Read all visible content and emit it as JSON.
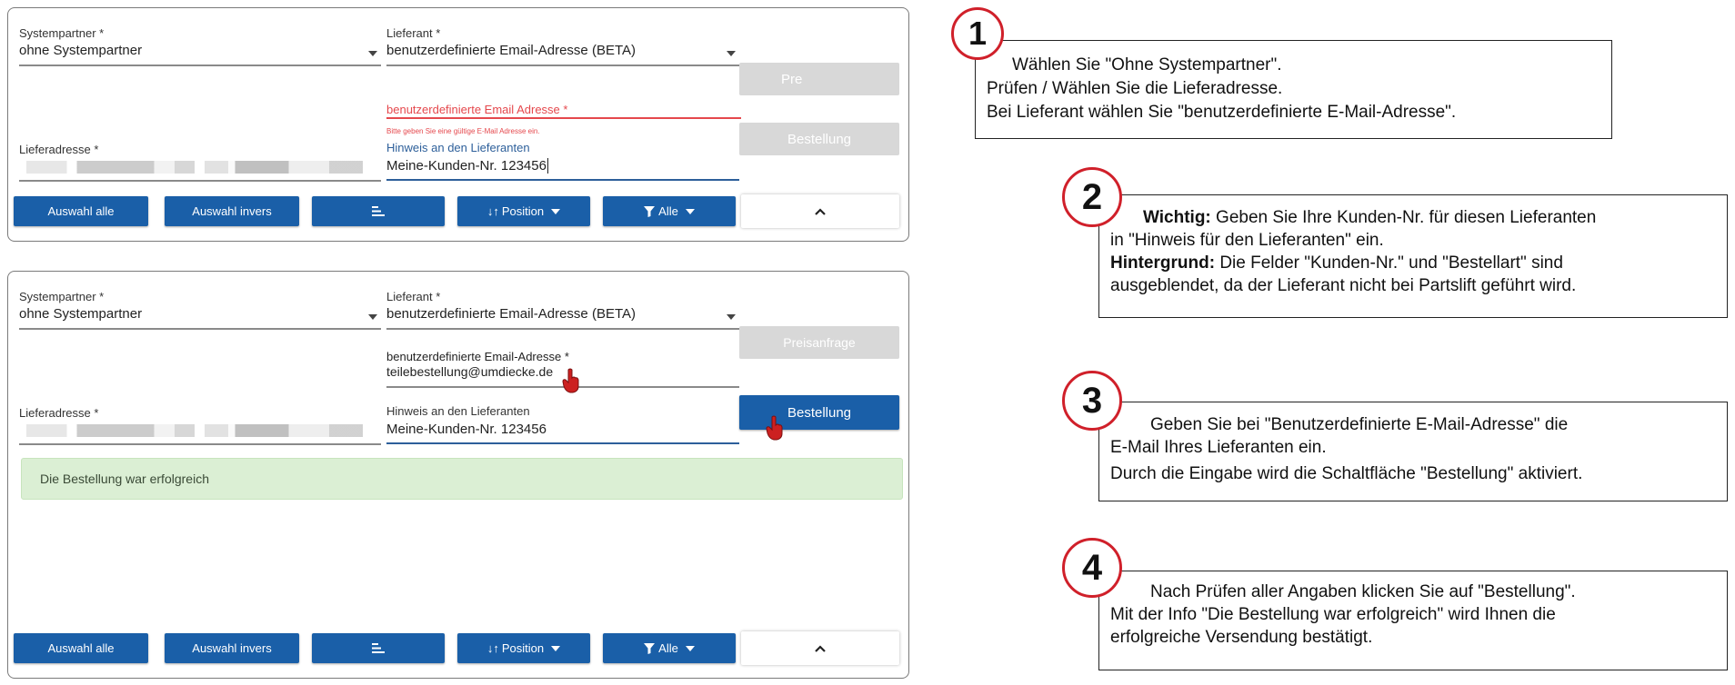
{
  "panel1": {
    "systempartner_label": "Systempartner *",
    "systempartner_value": "ohne Systempartner",
    "lieferant_label": "Lieferant *",
    "lieferant_value": "benutzerdefinierte Email-Adresse (BETA)",
    "email_label": "benutzerdefinierte Email Adresse *",
    "email_error": "Bitte geben Sie eine gültige E-Mail Adresse ein.",
    "hinweis_label": "Hinweis an den Lieferanten",
    "hinweis_value": "Meine-Kunden-Nr. 123456",
    "lieferadresse_label": "Lieferadresse *",
    "preisanfrage_button": "Pre",
    "bestellung_button": "Bestellung",
    "auswahl_alle": "Auswahl alle",
    "auswahl_invers": "Auswahl invers",
    "position": "Position",
    "filter": "Alle"
  },
  "panel2": {
    "systempartner_label": "Systempartner *",
    "systempartner_value": "ohne Systempartner",
    "lieferant_label": "Lieferant *",
    "lieferant_value": "benutzerdefinierte Email-Adresse (BETA)",
    "email_label": "benutzerdefinierte Email-Adresse *",
    "email_value": "teilebestellung@umdiecke.de",
    "hinweis_label": "Hinweis an den Lieferanten",
    "hinweis_value": "Meine-Kunden-Nr. 123456",
    "lieferadresse_label": "Lieferadresse *",
    "preisanfrage_button": "Preisanfrage",
    "bestellung_button": "Bestellung",
    "success_message": "Die Bestellung war erfolgreich",
    "auswahl_alle": "Auswahl alle",
    "auswahl_invers": "Auswahl invers",
    "position": "Position",
    "filter": "Alle"
  },
  "callouts": {
    "c1": {
      "number": "1",
      "line1": "Wählen Sie \"Ohne Systempartner\".",
      "line2": "Prüfen / Wählen Sie die Lieferadresse.",
      "line3": "Bei Lieferant wählen Sie \"benutzerdefinierte E-Mail-Adresse\"."
    },
    "c2": {
      "number": "2",
      "bold1": "Wichtig:",
      "text1": " Geben Sie Ihre Kunden-Nr. für diesen Lieferanten",
      "line2": "in \"Hinweis für den Lieferanten\" ein.",
      "bold3": "Hintergrund:",
      "text3": " Die Felder \"Kunden-Nr.\" und \"Bestellart\" sind",
      "line4": "ausgeblendet, da der Lieferant nicht bei Partslift geführt wird."
    },
    "c3": {
      "number": "3",
      "line1": "Geben Sie bei \"Benutzerdefinierte E-Mail-Adresse\" die",
      "line2": "E-Mail Ihres Lieferanten ein.",
      "line3": "Durch die Eingabe wird die Schaltfläche \"Bestellung\" aktiviert."
    },
    "c4": {
      "number": "4",
      "line1": "Nach Prüfen aller Angaben klicken Sie auf \"Bestellung\".",
      "line2": "Mit der Info \"Die Bestellung war erfolgreich\" wird Ihnen die",
      "line3": "erfolgreiche Versendung bestätigt."
    }
  },
  "colors": {
    "primary_blue": "#1a5fa8",
    "error_red": "#e5484d",
    "badge_red": "#d0202a",
    "success_green": "#dbefd4"
  },
  "icons": [
    "chevron-down-icon",
    "sort-icon",
    "sort-arrows-icon",
    "filter-icon",
    "chevron-up-icon",
    "pointer-hand-icon"
  ]
}
